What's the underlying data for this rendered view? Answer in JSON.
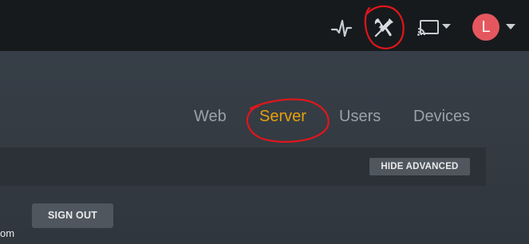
{
  "header": {
    "icons": {
      "activity": "activity-icon",
      "settings": "wrench-screwdriver-icon",
      "cast": "cast-icon",
      "caret": "chevron-down-icon"
    },
    "avatar_initial": "L",
    "avatar_color": "#e5575f"
  },
  "tabs": [
    {
      "label": "Web",
      "active": false
    },
    {
      "label": "Server",
      "active": true
    },
    {
      "label": "Users",
      "active": false
    },
    {
      "label": "Devices",
      "active": false
    }
  ],
  "toolbar": {
    "hide_advanced_label": "HIDE ADVANCED"
  },
  "account": {
    "sign_out_label": "SIGN OUT",
    "cut_off_text": "om"
  },
  "colors": {
    "topbar_bg": "#171a1d",
    "page_bg": "#343b43",
    "accent": "#e5a00d",
    "annotation": "#e0161b",
    "button_bg": "#4f565d"
  }
}
